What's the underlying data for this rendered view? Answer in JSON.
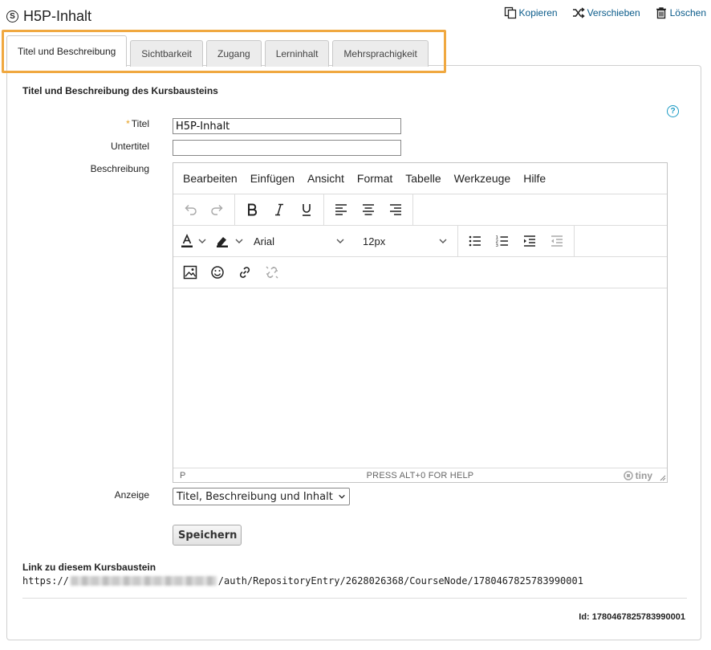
{
  "header": {
    "title": "H5P-Inhalt",
    "title_icon": "course-node-icon",
    "actions": {
      "copy": "Kopieren",
      "move": "Verschieben",
      "delete": "Löschen"
    }
  },
  "tabs": [
    {
      "label": "Titel und Beschreibung",
      "active": true
    },
    {
      "label": "Sichtbarkeit",
      "active": false
    },
    {
      "label": "Zugang",
      "active": false
    },
    {
      "label": "Lerninhalt",
      "active": false
    },
    {
      "label": "Mehrsprachigkeit",
      "active": false
    }
  ],
  "form": {
    "section_title": "Titel und Beschreibung des Kursbausteins",
    "title_label": "Titel",
    "required_marker": "*",
    "title_value": "H5P-Inhalt",
    "subtitle_label": "Untertitel",
    "subtitle_value": "",
    "description_label": "Beschreibung",
    "display_label": "Anzeige",
    "display_value": "Titel, Beschreibung und Inhalt",
    "save_label": "Speichern"
  },
  "editor": {
    "menu": [
      "Bearbeiten",
      "Einfügen",
      "Ansicht",
      "Format",
      "Tabelle",
      "Werkzeuge",
      "Hilfe"
    ],
    "font_family": "Arial",
    "font_size": "12px",
    "status_path": "P",
    "status_help": "PRESS ALT+0 FOR HELP",
    "brand": "tiny"
  },
  "link": {
    "title": "Link zu diesem Kursbaustein",
    "prefix": "https://",
    "suffix": "/auth/RepositoryEntry/2628026368/CourseNode/1780467825783990001"
  },
  "node_id": "Id: 1780467825783990001",
  "colors": {
    "accent_link": "#0a5b8a",
    "tab_highlight": "#f0a840",
    "help_icon": "#1a9ac4",
    "required": "#e6a020"
  }
}
